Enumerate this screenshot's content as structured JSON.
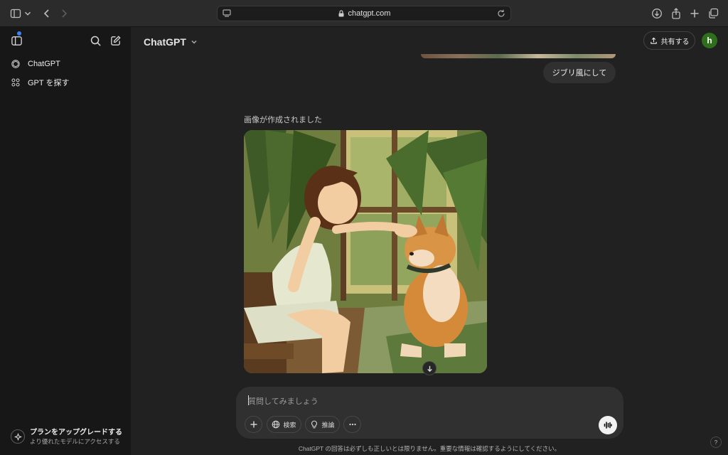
{
  "browser": {
    "url": "chatgpt.com"
  },
  "sidebar": {
    "items": [
      {
        "label": "ChatGPT",
        "icon": "openai-logo-icon"
      },
      {
        "label": "GPT を探す",
        "icon": "grid-icon"
      }
    ],
    "upgrade": {
      "title": "プランをアップグレードする",
      "subtitle": "より優れたモデルにアクセスする"
    }
  },
  "header": {
    "model": "ChatGPT",
    "share_label": "共有する",
    "avatar_initial": "h"
  },
  "conversation": {
    "user_message": "ジブリ風にして",
    "status": "画像が作成されました",
    "image_description_icon": "generated-image"
  },
  "composer": {
    "placeholder": "質問してみましょう",
    "search_label": "検索",
    "reason_label": "推論"
  },
  "footer": {
    "disclaimer": "ChatGPT の回答は必ずしも正しいとは限りません。重要な情報は確認するようにしてください。",
    "help": "?"
  },
  "colors": {
    "accent_dot": "#3b82f6",
    "avatar_bg": "#2f6f1c"
  }
}
